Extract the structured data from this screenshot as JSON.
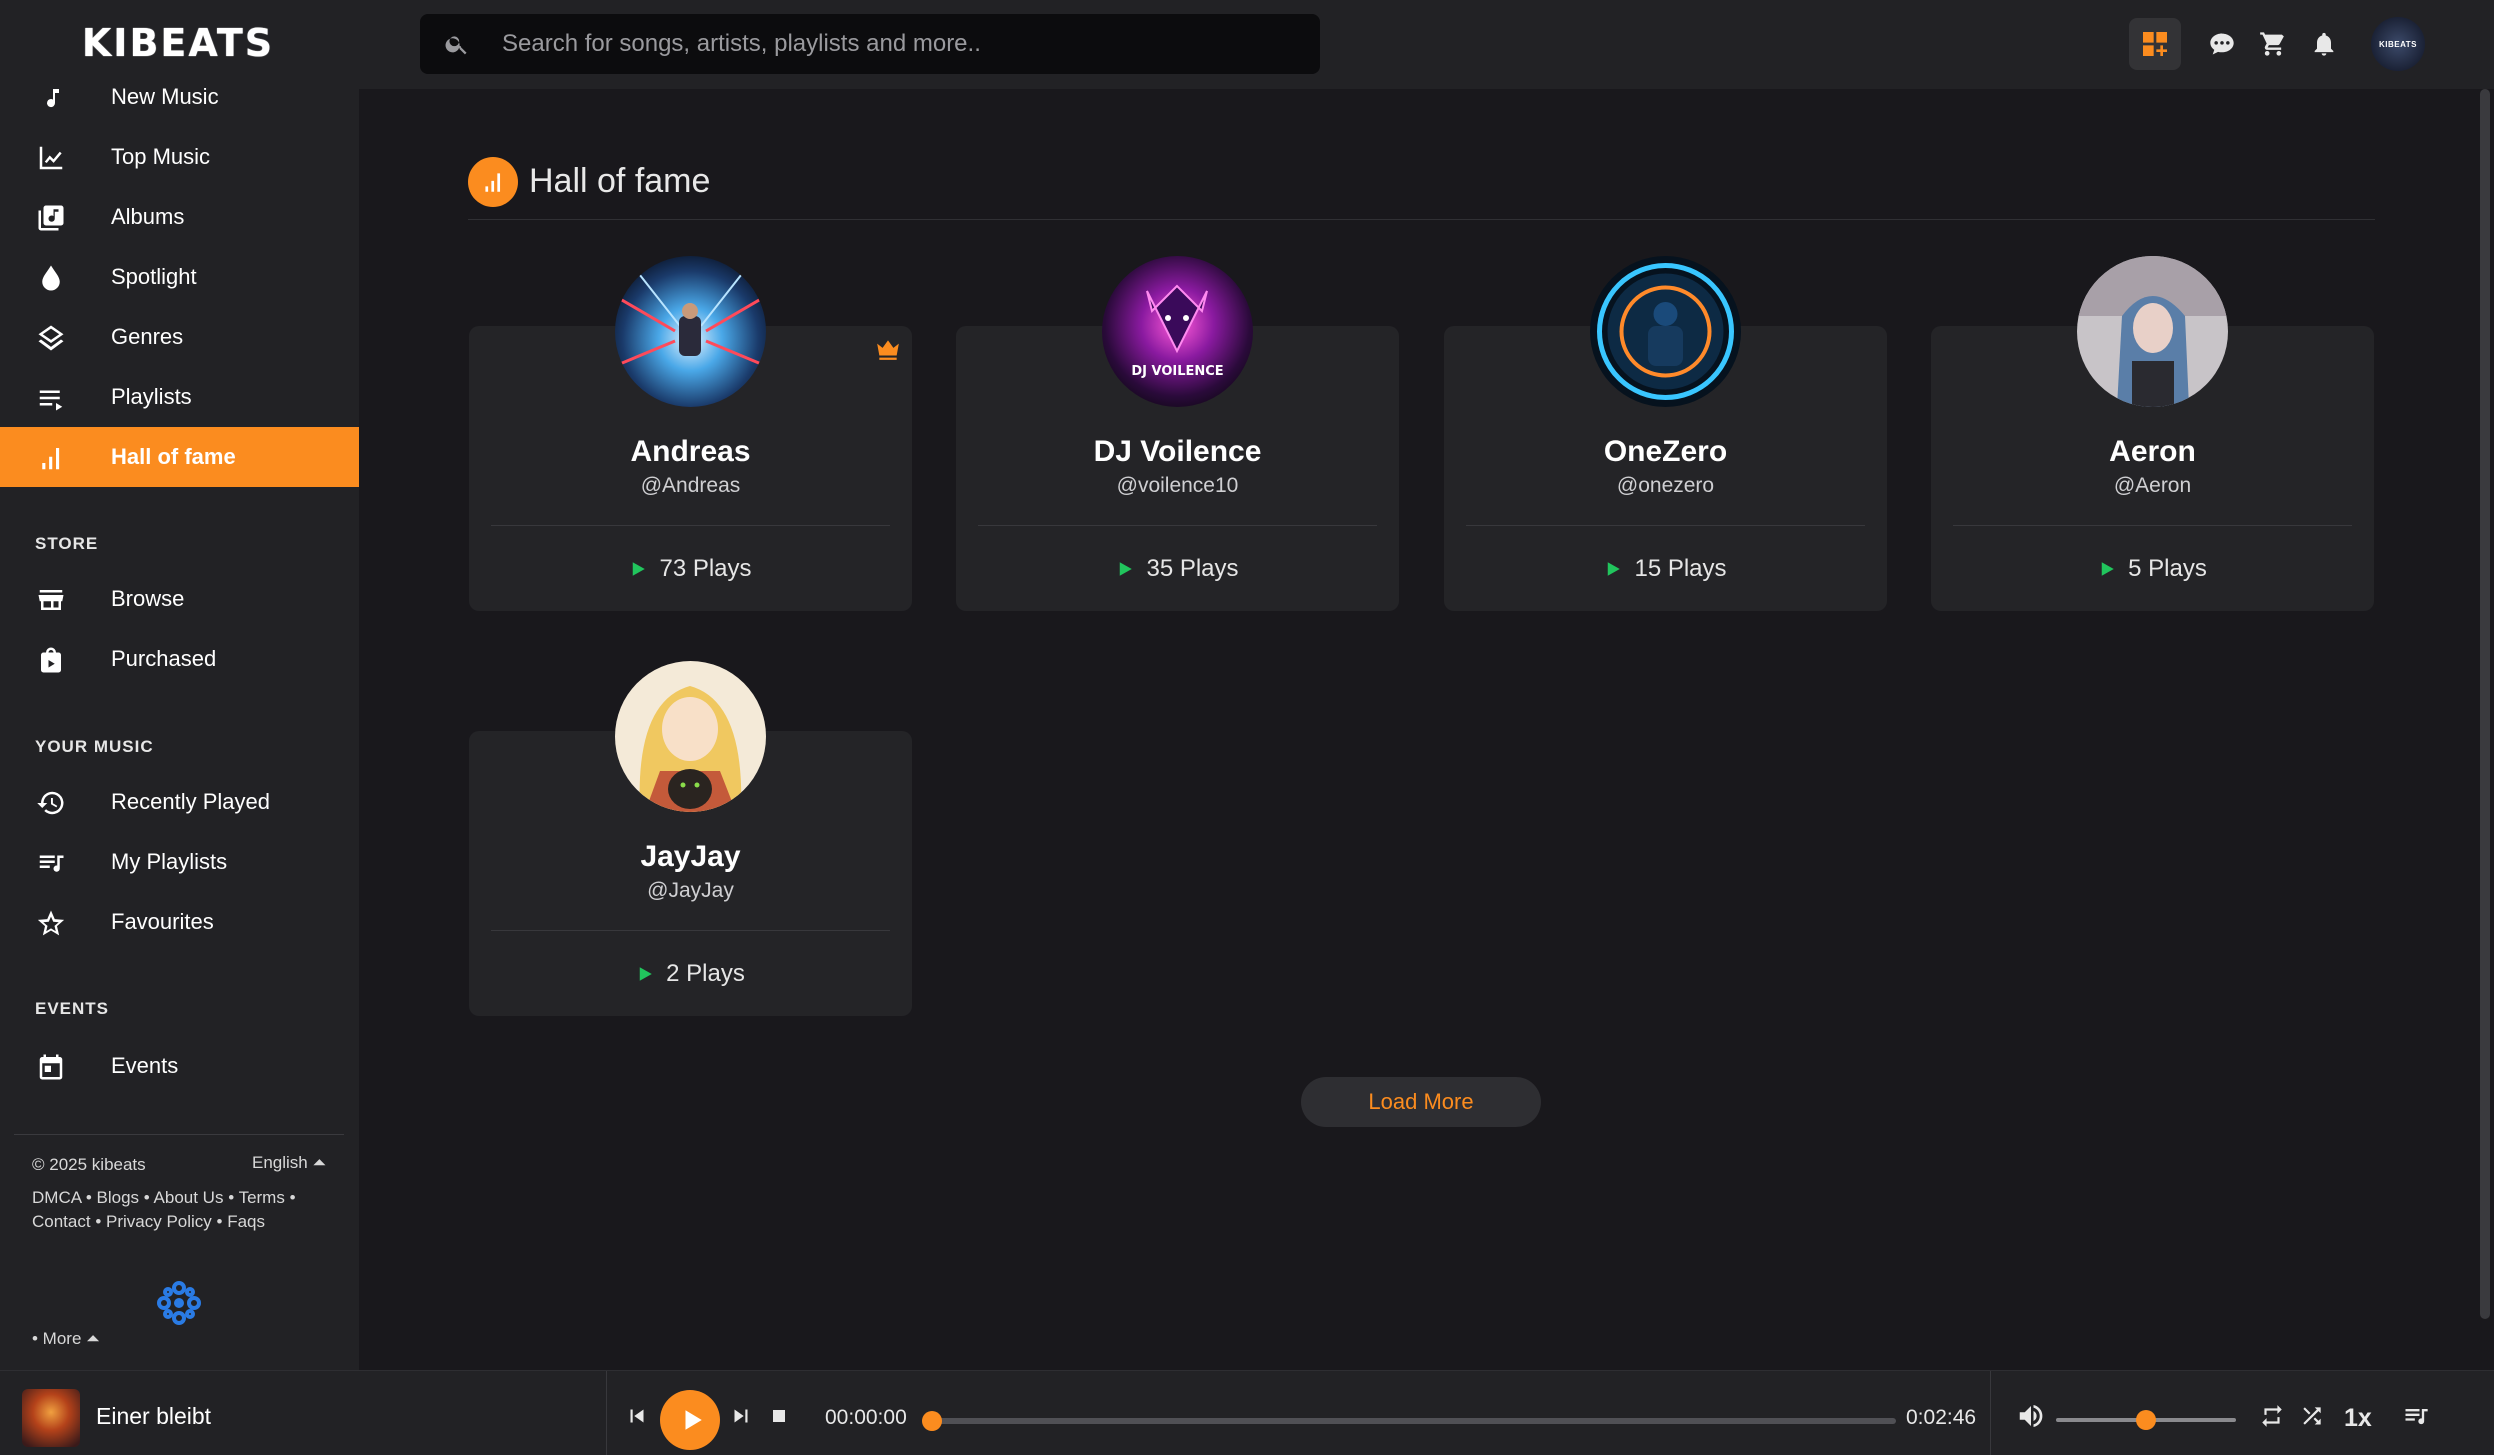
{
  "app": {
    "logo_text": "KIBEATS"
  },
  "sidebar": {
    "main_items": [
      {
        "label": "New Music",
        "icon": "music-note-icon"
      },
      {
        "label": "Top Music",
        "icon": "trending-chart-icon"
      },
      {
        "label": "Albums",
        "icon": "album-library-icon"
      },
      {
        "label": "Spotlight",
        "icon": "drop-icon"
      },
      {
        "label": "Genres",
        "icon": "layers-icon"
      },
      {
        "label": "Playlists",
        "icon": "playlist-icon"
      },
      {
        "label": "Hall of fame",
        "icon": "bar-chart-icon",
        "active": true
      }
    ],
    "store_header": "STORE",
    "store_items": [
      {
        "label": "Browse",
        "icon": "storefront-icon"
      },
      {
        "label": "Purchased",
        "icon": "shopping-bag-icon"
      }
    ],
    "your_music_header": "YOUR MUSIC",
    "your_music_items": [
      {
        "label": "Recently Played",
        "icon": "history-icon"
      },
      {
        "label": "My Playlists",
        "icon": "playlist-music-icon"
      },
      {
        "label": "Favourites",
        "icon": "star-icon"
      }
    ],
    "events_header": "EVENTS",
    "events_items": [
      {
        "label": "Events",
        "icon": "calendar-icon"
      }
    ],
    "footer": {
      "copyright": "© 2025 kibeats",
      "language": "English ⏶",
      "links": [
        "DMCA",
        "Blogs",
        "About Us",
        "Terms",
        "Contact",
        "Privacy Policy",
        "Faqs"
      ],
      "more": "• More ⏶"
    }
  },
  "topbar": {
    "search_placeholder": "Search for songs, artists, playlists and more..",
    "search_value": "",
    "avatar_text": "KIBEATS"
  },
  "main": {
    "title": "Hall of fame",
    "artists": [
      {
        "name": "Andreas",
        "handle": "@Andreas",
        "plays": "73 Plays",
        "crown": true
      },
      {
        "name": "DJ Voilence",
        "handle": "@voilence10",
        "plays": "35 Plays",
        "avatar_text": "DJ VOILENCE"
      },
      {
        "name": "OneZero",
        "handle": "@onezero",
        "plays": "15 Plays"
      },
      {
        "name": "Aeron",
        "handle": "@Aeron",
        "plays": "5 Plays"
      },
      {
        "name": "JayJay",
        "handle": "@JayJay",
        "plays": "2 Plays"
      }
    ],
    "load_more": "Load More"
  },
  "player": {
    "track_title": "Einer bleibt",
    "current_time": "00:00:00",
    "duration": "0:02:46",
    "progress": 0,
    "volume": 0.5,
    "speed": "1x"
  },
  "colors": {
    "accent": "#fb8c1f",
    "play_green": "#21c55d",
    "background": "#19181c",
    "panel": "#222225",
    "card": "#242427"
  }
}
